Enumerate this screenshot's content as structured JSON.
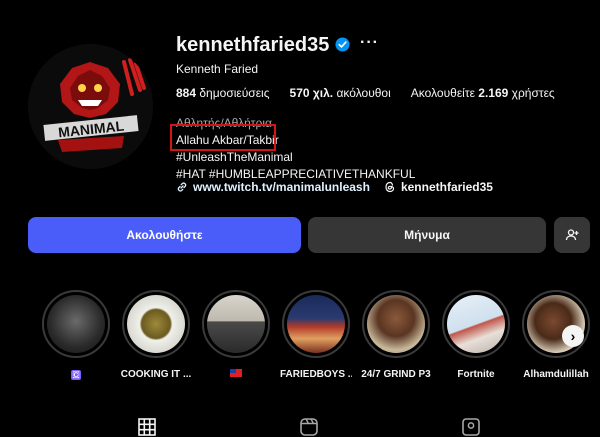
{
  "profile": {
    "username": "kennethfaried35",
    "full_name": "Kenneth Faried",
    "avatar_text": "MANIMAL"
  },
  "stats": {
    "posts_count": "884",
    "posts_label": "δημοσιεύσεις",
    "followers_count": "570 χιλ.",
    "followers_label": "ακόλουθοι",
    "following_prefix": "Ακολουθείτε",
    "following_count": "2.169",
    "following_label": "χρήστες"
  },
  "bio": {
    "category": "Αθλητής/Αθλήτρια",
    "lines": [
      "Allahu Akbar/Takbir",
      "#UnleashTheManimal",
      "#HAT #HUMBLEAPPRECIATIVETHANKFUL"
    ]
  },
  "links": {
    "website": "www.twitch.tv/manimalunleash",
    "threads": "kennethfaried35"
  },
  "buttons": {
    "follow": "Ακολουθήστε",
    "message": "Μήνυμα"
  },
  "highlights": [
    {
      "label": "",
      "flag": "🇨"
    },
    {
      "label": "COOKING IT ..."
    },
    {
      "label": "🇹🇼"
    },
    {
      "label": "FARIEDBOYS ..."
    },
    {
      "label": "24/7 GRIND P3"
    },
    {
      "label": "Fortnite"
    },
    {
      "label": "Alhamdulillah"
    }
  ],
  "colors": {
    "follow_button": "#4a5df9",
    "secondary_button": "#363636",
    "highlight_box": "#d01515",
    "verified": "#0095f6"
  }
}
